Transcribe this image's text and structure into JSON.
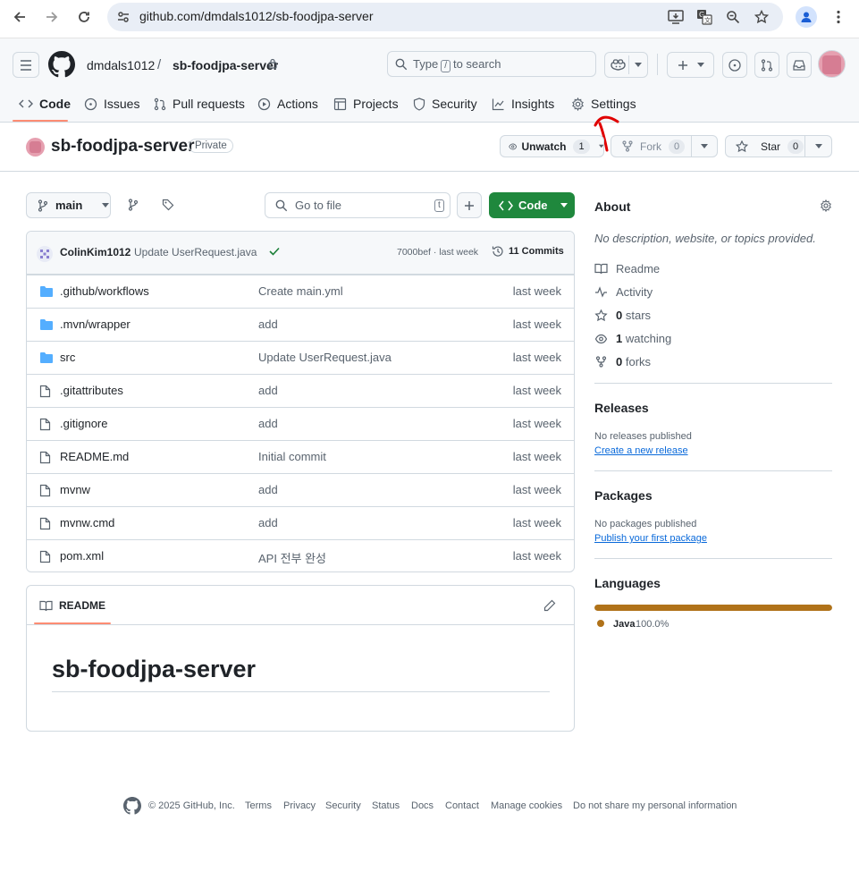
{
  "browser": {
    "url": "github.com/dmdals1012/sb-foodjpa-server"
  },
  "header": {
    "owner": "dmdals1012",
    "separator": "/",
    "repo": "sb-foodjpa-server",
    "search_prefix": "Type",
    "search_key": "/",
    "search_suffix": "to search"
  },
  "tabs": [
    {
      "label": "Code",
      "icon": "code-icon"
    },
    {
      "label": "Issues",
      "icon": "issue-icon"
    },
    {
      "label": "Pull requests",
      "icon": "pull-request-icon"
    },
    {
      "label": "Actions",
      "icon": "play-icon"
    },
    {
      "label": "Projects",
      "icon": "table-icon"
    },
    {
      "label": "Security",
      "icon": "shield-icon"
    },
    {
      "label": "Insights",
      "icon": "graph-icon"
    },
    {
      "label": "Settings",
      "icon": "gear-icon"
    }
  ],
  "repo_header": {
    "name": "sb-foodjpa-server",
    "visibility": "Private",
    "unwatch_label": "Unwatch",
    "watch_count": "1",
    "fork_label": "Fork",
    "fork_count": "0",
    "star_label": "Star",
    "star_count": "0"
  },
  "toolbar": {
    "branch": "main",
    "goto_placeholder": "Go to file",
    "goto_key": "t",
    "code_label": "Code"
  },
  "commit": {
    "author": "ColinKim1012",
    "message": "Update UserRequest.java",
    "meta": "7000bef · last week",
    "commits_label": "11 Commits"
  },
  "files": [
    {
      "name": ".github/workflows",
      "type": "folder",
      "message": "Create main.yml",
      "date": "last week"
    },
    {
      "name": ".mvn/wrapper",
      "type": "folder",
      "message": "add",
      "date": "last week"
    },
    {
      "name": "src",
      "type": "folder",
      "message": "Update UserRequest.java",
      "date": "last week"
    },
    {
      "name": ".gitattributes",
      "type": "file",
      "message": "add",
      "date": "last week"
    },
    {
      "name": ".gitignore",
      "type": "file",
      "message": "add",
      "date": "last week"
    },
    {
      "name": "README.md",
      "type": "file",
      "message": "Initial commit",
      "date": "last week"
    },
    {
      "name": "mvnw",
      "type": "file",
      "message": "add",
      "date": "last week"
    },
    {
      "name": "mvnw.cmd",
      "type": "file",
      "message": "add",
      "date": "last week"
    },
    {
      "name": "pom.xml",
      "type": "file",
      "message": "API 전부 완성",
      "date": "last week"
    }
  ],
  "readme": {
    "tab_label": "README",
    "heading": "sb-foodjpa-server"
  },
  "about": {
    "title": "About",
    "description": "No description, website, or topics provided.",
    "items": [
      {
        "label": "Readme",
        "icon": "book-icon",
        "bold": ""
      },
      {
        "label": "Activity",
        "icon": "pulse-icon",
        "bold": ""
      },
      {
        "label": "stars",
        "icon": "star-icon",
        "bold": "0"
      },
      {
        "label": "watching",
        "icon": "eye-icon",
        "bold": "1"
      },
      {
        "label": "forks",
        "icon": "fork-icon",
        "bold": "0"
      }
    ]
  },
  "releases": {
    "title": "Releases",
    "text": "No releases published",
    "link": "Create a new release"
  },
  "packages": {
    "title": "Packages",
    "text": "No packages published",
    "link": "Publish your first package"
  },
  "languages": {
    "title": "Languages",
    "name": "Java",
    "percent": "100.0%",
    "share": 1.0,
    "color": "#b07219"
  },
  "footer": {
    "copyright": "© 2025 GitHub, Inc.",
    "links": [
      "Terms",
      "Privacy",
      "Security",
      "Status",
      "Docs",
      "Contact",
      "Manage cookies",
      "Do not share my personal information"
    ]
  }
}
